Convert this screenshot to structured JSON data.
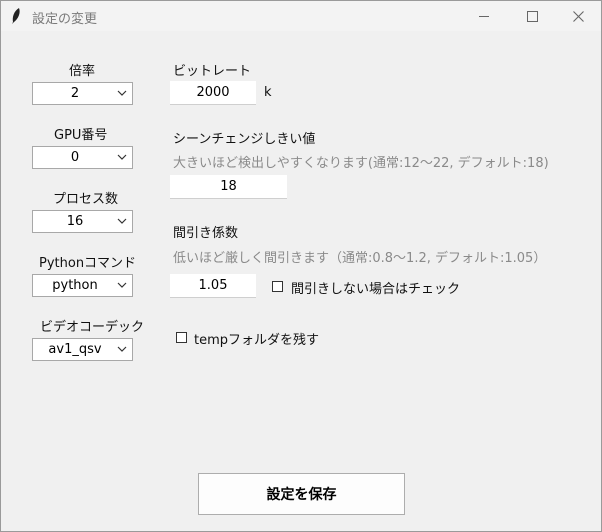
{
  "window": {
    "title": "設定の変更",
    "controls": {
      "minimize": "minimize-icon",
      "maximize": "maximize-icon",
      "close": "close-icon"
    }
  },
  "left": {
    "scale": {
      "label": "倍率",
      "value": "2"
    },
    "gpu": {
      "label": "GPU番号",
      "value": "0"
    },
    "processes": {
      "label": "プロセス数",
      "value": "16"
    },
    "python": {
      "label": "Pythonコマンド",
      "value": "python"
    },
    "codec": {
      "label": "ビデオコーデック",
      "value": "av1_qsv"
    }
  },
  "right": {
    "bitrate": {
      "label": "ビットレート",
      "value": "2000",
      "unit": "k"
    },
    "scene": {
      "label": "シーンチェンジしきい値",
      "hint": "大きいほど検出しやすくなります(通常:12～22, デフォルト:18)",
      "value": "18"
    },
    "decimate": {
      "label": "間引き係数",
      "hint": "低いほど厳しく間引きます（通常:0.8～1.2, デフォルト:1.05）",
      "value": "1.05",
      "check_label": "間引きしない場合はチェック",
      "checked": false
    },
    "temp": {
      "check_label": "tempフォルダを残す",
      "checked": false
    }
  },
  "save_button": "設定を保存",
  "colors": {
    "background": "#f0f0f0",
    "hint_text": "#8a8a8a",
    "field_bg": "#ffffff",
    "border": "#a8a8a8"
  }
}
